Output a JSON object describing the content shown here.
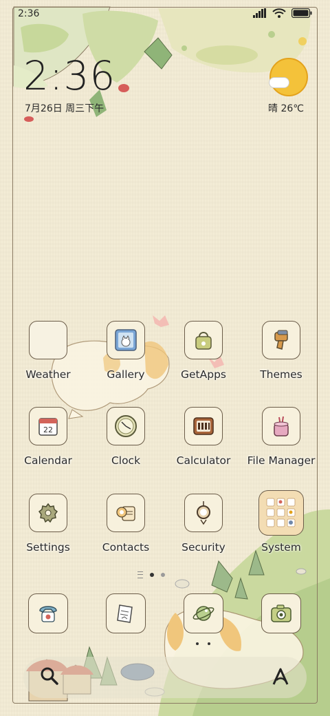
{
  "status_bar": {
    "time": "2:36",
    "icons": [
      "signal-icon",
      "wifi-icon",
      "battery-icon"
    ]
  },
  "clock_widget": {
    "time": "2:36",
    "date": "7月26日 周三下午",
    "weather": "晴 26℃"
  },
  "apps": [
    {
      "label": "Weather",
      "icon": "weather-icon"
    },
    {
      "label": "Gallery",
      "icon": "gallery-icon"
    },
    {
      "label": "GetApps",
      "icon": "getapps-bag-icon"
    },
    {
      "label": "Themes",
      "icon": "themes-brush-icon"
    },
    {
      "label": "Calendar",
      "icon": "calendar-icon"
    },
    {
      "label": "Clock",
      "icon": "clock-icon"
    },
    {
      "label": "Calculator",
      "icon": "calculator-icon"
    },
    {
      "label": "File Manager",
      "icon": "file-manager-icon"
    },
    {
      "label": "Settings",
      "icon": "settings-gear-icon"
    },
    {
      "label": "Contacts",
      "icon": "contacts-icon"
    },
    {
      "label": "Security",
      "icon": "security-icon"
    },
    {
      "label": "System",
      "icon": "system-folder-icon"
    }
  ],
  "calendar_day": "22",
  "page_indicator": {
    "pages": 2,
    "active": 0
  },
  "dock": [
    {
      "icon": "phone-icon"
    },
    {
      "icon": "notes-icon"
    },
    {
      "icon": "browser-planet-icon"
    },
    {
      "icon": "camera-icon"
    }
  ],
  "search": {
    "icon": "search-icon",
    "assistant_icon": "assistant-icon"
  },
  "colors": {
    "background": "#f3ecd4",
    "tile_border": "#6a5b48",
    "sun": "#f4c23a",
    "grass": "#b9cf8e"
  }
}
